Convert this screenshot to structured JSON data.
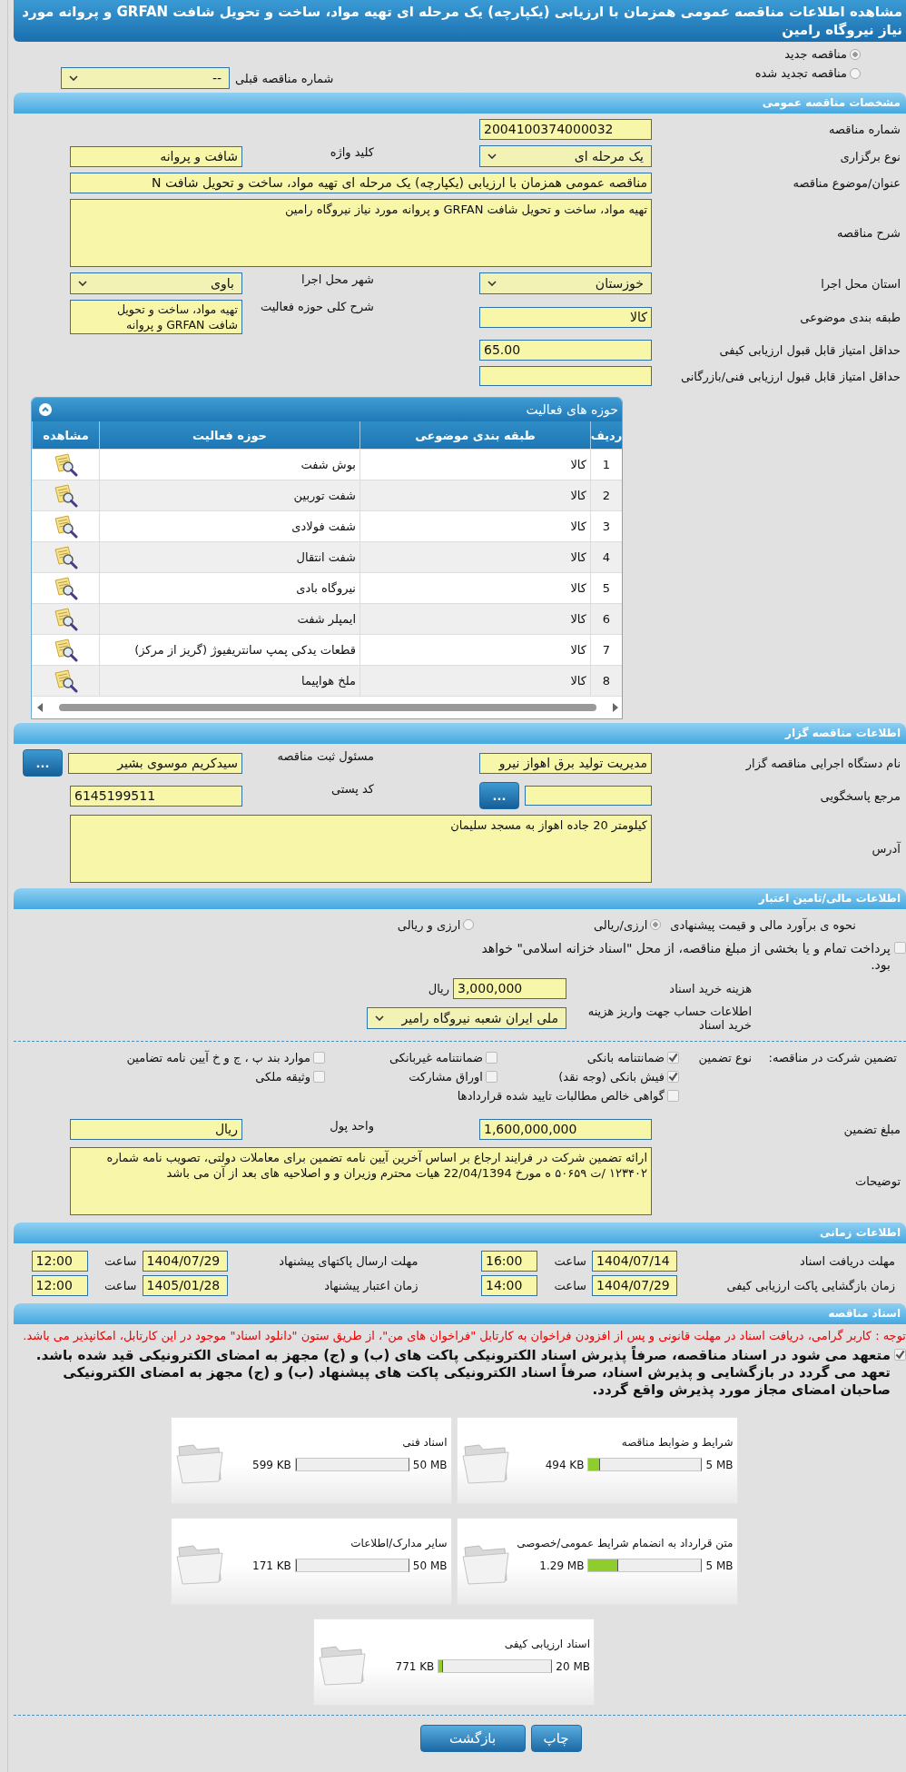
{
  "page_title": "مشاهده اطلاعات مناقصه عمومی همزمان با ارزیابی (یکپارچه) یک مرحله ای تهیه مواد، ساخت و تحویل شافت GRFAN و پروانه مورد نیاز نیروگاه رامین",
  "tender_type_options": [
    {
      "label": "مناقصه جدید",
      "selected": true
    },
    {
      "label": "مناقصه تجدید شده",
      "selected": false
    }
  ],
  "previous_tender": {
    "label": "شماره مناقصه قبلی",
    "value": "--"
  },
  "general": {
    "header": "مشخصات مناقصه عمومی",
    "rows": [
      {
        "fields": [
          {
            "kind": "text",
            "label": "شماره مناقصه",
            "value": "2004100374000032"
          }
        ]
      },
      {
        "fields": [
          {
            "kind": "select",
            "label": "نوع برگزاری",
            "value": "یک مرحله ای"
          },
          {
            "kind": "text",
            "label": "کلید واژه",
            "value": "شافت و پروانه"
          }
        ]
      },
      {
        "fields": [
          {
            "kind": "long_text",
            "label": "عنوان/موضوع مناقصه",
            "value": "مناقصه عمومی همزمان با ارزیابی (یکپارچه) یک مرحله ای تهیه مواد، ساخت و تحویل شافت N"
          }
        ]
      },
      {
        "fields": [
          {
            "kind": "textarea",
            "label": "شرح مناقصه",
            "value": "تهیه مواد، ساخت و تحویل شافت GRFAN و پروانه مورد نیاز نیروگاه رامین"
          }
        ]
      },
      {
        "fields": [
          {
            "kind": "select",
            "label": "استان محل اجرا",
            "value": "خوزستان"
          },
          {
            "kind": "select",
            "label": "شهر محل اجرا",
            "value": "باوی"
          }
        ]
      },
      {
        "fields": [
          {
            "kind": "text",
            "label": "طبقه بندی موضوعی",
            "value": "کالا"
          },
          {
            "kind": "listbox",
            "label": "شرح کلی حوزه فعالیت",
            "value": "تهیه مواد، ساخت و تحویل شافت GRFAN و پروانه"
          }
        ]
      },
      {
        "fields": [
          {
            "kind": "text",
            "label": "حداقل امتیاز قابل قبول ارزیابی کیفی",
            "value": "65.00"
          }
        ]
      },
      {
        "fields": [
          {
            "kind": "text",
            "label": "حداقل امتیاز قابل قبول ارزیابی فنی/بازرگانی"
          }
        ]
      }
    ]
  },
  "activities": {
    "title": "حوزه های فعالیت",
    "columns": [
      "ردیف",
      "طبقه بندی موضوعی",
      "حوزه فعالیت",
      "مشاهده"
    ],
    "rows": [
      {
        "index": "1",
        "category": "کالا",
        "activity": "بوش شفت"
      },
      {
        "index": "2",
        "category": "کالا",
        "activity": "شفت توربین"
      },
      {
        "index": "3",
        "category": "کالا",
        "activity": "شفت فولادی"
      },
      {
        "index": "4",
        "category": "کالا",
        "activity": "شفت انتقال"
      },
      {
        "index": "5",
        "category": "کالا",
        "activity": "نیروگاه بادی"
      },
      {
        "index": "6",
        "category": "کالا",
        "activity": "ایمپلر شفت"
      },
      {
        "index": "7",
        "category": "کالا",
        "activity": "قطعات یدکی پمپ سانتریفیوژ (گریز از مرکز)"
      },
      {
        "index": "8",
        "category": "کالا",
        "activity": "ملخ هواپیما"
      }
    ]
  },
  "contractor": {
    "header": "اطلاعات مناقصه گزار",
    "rows": [
      {
        "fields": [
          {
            "kind": "text",
            "label": "نام دستگاه اجرایی مناقصه گزار",
            "value": "مدیریت تولید برق اهواز نیرو"
          },
          {
            "kind": "text",
            "label": "مسئول ثبت مناقصه",
            "value": "سیدکریم موسوی بشیر",
            "button": "..."
          }
        ]
      },
      {
        "fields": [
          {
            "kind": "text",
            "label": "مرجع پاسخگویی",
            "button": "..."
          },
          {
            "kind": "text",
            "label": "کد پستی",
            "value": "6145199511"
          }
        ]
      },
      {
        "fields": [
          {
            "kind": "textarea",
            "label": "آدرس",
            "value": "کیلومتر 20 جاده اهواز به مسجد سلیمان"
          }
        ]
      }
    ]
  },
  "finance": {
    "header": "اطلاعات مالی/تامین اعتبار",
    "estimate": {
      "label": "نحوه ی برآورد مالی و قیمت پیشنهادی",
      "options": [
        {
          "label": "ارزی/ریالی",
          "selected": true
        },
        {
          "label": "ارزی و ریالی",
          "selected": false
        }
      ]
    },
    "treasury": {
      "label": "پرداخت تمام و یا بخشی از مبلغ مناقصه، از محل \"اسناد خزانه اسلامی\" خواهد بود.",
      "checked": false
    },
    "fee": {
      "label": "هزینه خرید اسناد",
      "value": "3,000,000",
      "unit": "ریال"
    },
    "account": {
      "label": "اطلاعات حساب جهت واریز هزینه خرید اسناد",
      "value": "ملی ایران شعبه نیروگاه رامیر"
    },
    "guarantee": {
      "label": "تضمین شرکت در مناقصه:",
      "type_label": "نوع تضمین",
      "options": [
        {
          "label": "ضمانتنامه بانکی",
          "checked": true
        },
        {
          "label": "ضمانتنامه غیربانکی",
          "checked": false
        },
        {
          "label": "موارد بند پ ، ج و خ آیین نامه تضامین",
          "checked": false
        },
        {
          "label": "فیش بانکی (وجه نقد)",
          "checked": true
        },
        {
          "label": "اوراق مشارکت",
          "checked": false
        },
        {
          "label": "وثیقه ملکی",
          "checked": false
        },
        {
          "label": "گواهی خالص مطالبات تایید شده قراردادها",
          "checked": false
        }
      ]
    },
    "amount": {
      "label": "مبلغ تضمین",
      "value": "1,600,000,000"
    },
    "currency": {
      "label": "واحد پول",
      "value": "ریال"
    },
    "notes": {
      "label": "توضیحات",
      "value": "ارائه تضمین شرکت در فرایند ارجاع بر اساس آخرین آیین نامه تضمین برای معاملات دولتی، تصویب نامه شماره ۱۲۳۴۰۲ /ت ۵۰۶۵۹ ه مورخ 22/04/1394 هیات محترم وزیران و و اصلاحیه های بعد از آن می باشد"
    }
  },
  "schedule": {
    "header": "اطلاعات زمانی",
    "items": [
      {
        "label": "مهلت دریافت اسناد",
        "date": "1404/07/14",
        "time_label": "ساعت",
        "time": "16:00"
      },
      {
        "label": "مهلت ارسال پاکتهای پیشنهاد",
        "date": "1404/07/29",
        "time_label": "ساعت",
        "time": "12:00"
      },
      {
        "label": "زمان بازگشایی پاکت ارزیابی کیفی",
        "date": "1404/07/29",
        "time_label": "ساعت",
        "time": "14:00"
      },
      {
        "label": "زمان اعتبار پیشنهاد",
        "date": "1405/01/28",
        "time_label": "ساعت",
        "time": "12:00"
      }
    ]
  },
  "documents": {
    "header": "اسناد مناقصه",
    "notice": "توجه : کاربر گرامی، دریافت اسناد در مهلت قانونی و پس از افزودن فراخوان به کارتابل \"فراخوان های من\"، از طریق ستون \"دانلود اسناد\" موجود در این کارتابل، امکانپذیر می باشد.",
    "commitment": {
      "label": "متعهد می شود در اسناد مناقصه، صرفاً پذیرش اسناد الکترونیکی پاکت های (ب) و (ج) مجهز به امضای الکترونیکی قید شده باشد. تعهد می گردد در بازگشایی و پذیرش اسناد، صرفاً اسناد الکترونیکی پاکت های پیشنهاد (ب) و (ج) مجهز به امضای الکترونیکی صاحبان امضای مجاز مورد پذیرش واقع گردد.",
      "checked": true
    },
    "files": [
      {
        "name": "شرایط و ضوابط مناقصه",
        "size": "494 KB",
        "max": "5 MB",
        "level": 0.1
      },
      {
        "name": "اسناد فنی",
        "size": "599 KB",
        "max": "50 MB",
        "level": 0.012
      },
      {
        "name": "متن قرارداد به انضمام شرایط عمومی/خصوصی",
        "size": "1.29 MB",
        "max": "5 MB",
        "level": 0.26
      },
      {
        "name": "سایر مدارک/اطلاعات",
        "size": "171 KB",
        "max": "50 MB",
        "level": 0.004
      },
      {
        "name": "اسناد ارزیابی کیفی",
        "size": "771 KB",
        "max": "20 MB",
        "level": 0.038
      }
    ]
  },
  "buttons": [
    "چاپ",
    "بازگشت"
  ]
}
